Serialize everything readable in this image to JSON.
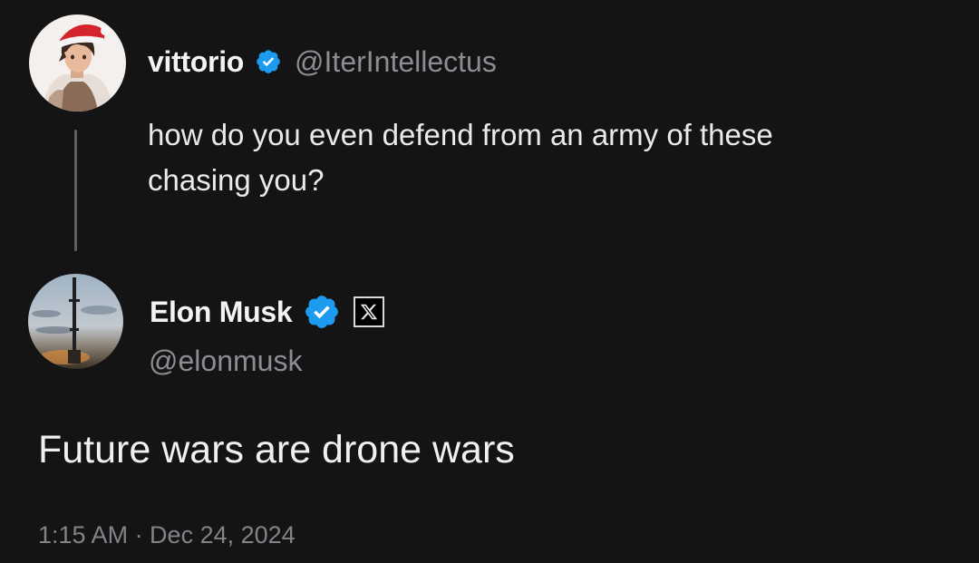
{
  "reply_to": {
    "display_name": "vittorio",
    "handle": "@IterIntellectus",
    "avatar_icon": "avatar-anime-santa-hat-icon",
    "text": "how do you even defend from an army of these chasing you?",
    "verified": true
  },
  "main_tweet": {
    "display_name": "Elon Musk",
    "handle": "@elonmusk",
    "avatar_icon": "avatar-rocket-launchpad-icon",
    "verified": true,
    "affiliate_badge_icon": "x-logo-icon",
    "text": "Future wars are drone wars",
    "timestamp": "1:15 AM · Dec 24, 2024"
  },
  "colors": {
    "background": "#141415",
    "verified_blue": "#1d9bf0",
    "secondary_text": "#8a8d92",
    "primary_text": "#e7e9ea"
  }
}
